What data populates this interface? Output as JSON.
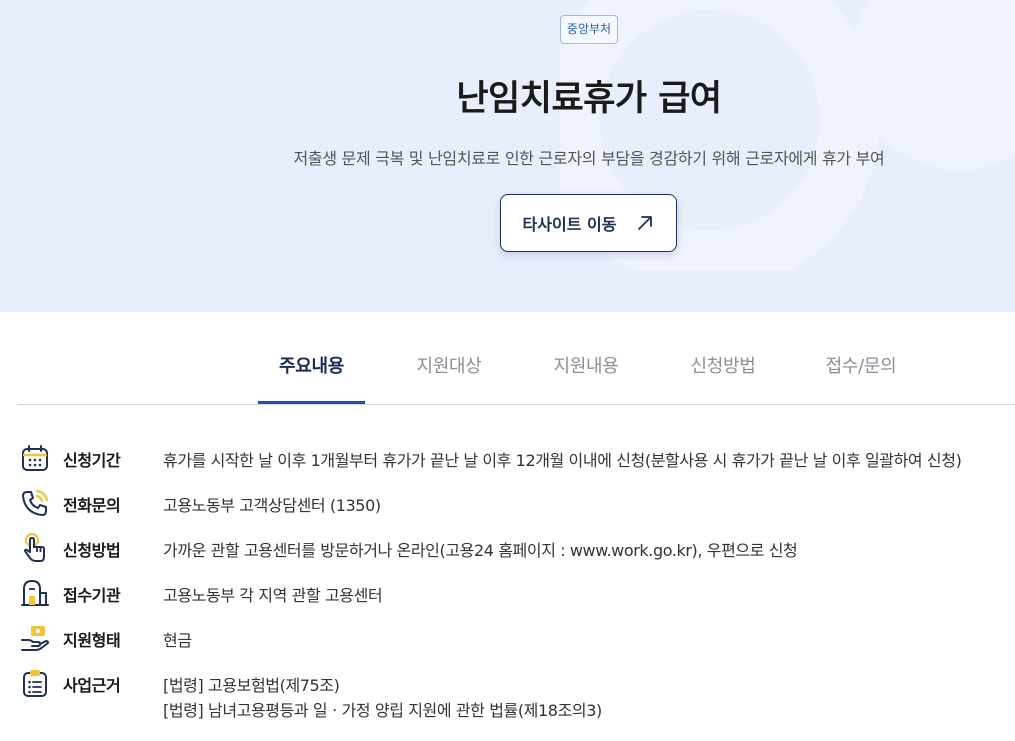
{
  "hero": {
    "badge": "중앙부처",
    "title": "난임치료휴가 급여",
    "subtitle": "저출생 문제 극복 및 난임치료로 인한 근로자의 부담을 경감하기 위해 근로자에게 휴가 부여",
    "link_button": "타사이트 이동",
    "link_icon": "external-arrow-icon"
  },
  "tabs": [
    {
      "label": "주요내용",
      "active": true
    },
    {
      "label": "지원대상",
      "active": false
    },
    {
      "label": "지원내용",
      "active": false
    },
    {
      "label": "신청방법",
      "active": false
    },
    {
      "label": "접수/문의",
      "active": false
    }
  ],
  "info": [
    {
      "icon": "calendar-icon",
      "label": "신청기간",
      "value": "휴가를 시작한 날 이후 1개월부터 휴가가 끝난 날 이후 12개월 이내에 신청(분할사용 시 휴가가 끝난 날 이후 일괄하여 신청)"
    },
    {
      "icon": "phone-icon",
      "label": "전화문의",
      "value": "고용노동부 고객상담센터 (1350)"
    },
    {
      "icon": "hand-pointer-icon",
      "label": "신청방법",
      "value": "가까운 관할 고용센터를 방문하거나 온라인(고용24 홈페이지 : www.work.go.kr), 우편으로 신청"
    },
    {
      "icon": "building-icon",
      "label": "접수기관",
      "value": "고용노동부 각 지역 관할 고용센터"
    },
    {
      "icon": "hand-money-icon",
      "label": "지원형태",
      "value": "현금"
    },
    {
      "icon": "clipboard-list-icon",
      "label": "사업근거",
      "value": "[법령] 고용보험법(제75조)",
      "value2": "[법령] 남녀고용평등과 일ㆍ가정 양립 지원에 관한 법률(제18조의3)"
    }
  ],
  "colors": {
    "accent": "#1f4fa8",
    "hero_bg": "#e7effd",
    "navy": "#1f2f55",
    "icon_yellow": "#f5c23a"
  }
}
